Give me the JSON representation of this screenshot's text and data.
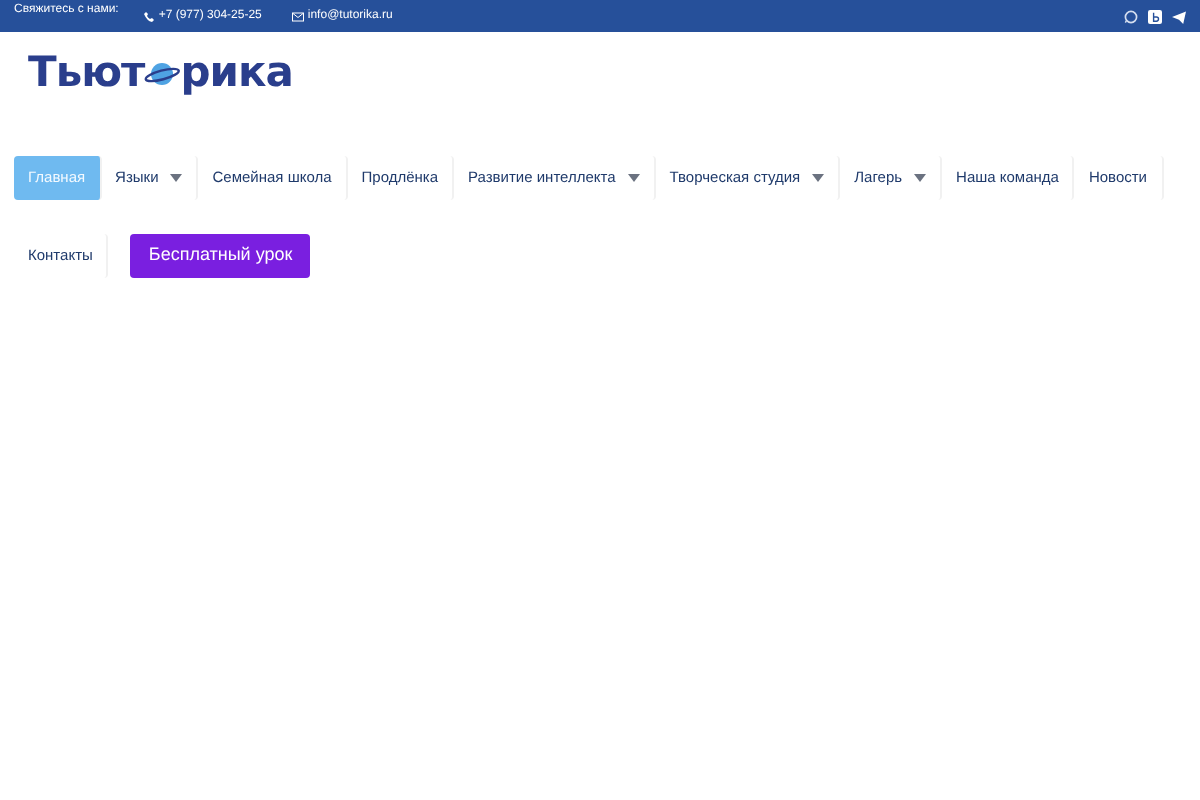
{
  "top_bar": {
    "contact_label": "Свяжитесь с нами:",
    "phone": "+7 (977) 304-25-25",
    "email": "info@tutorika.ru"
  },
  "logo": {
    "text_before_planet": "Тьют",
    "text_after_planet": "рика"
  },
  "nav": [
    {
      "label": "Главная",
      "selected": true,
      "kind": "link",
      "submenu": false
    },
    {
      "label": "Языки",
      "selected": false,
      "kind": "link",
      "submenu": true
    },
    {
      "label": "Семейная школа",
      "selected": false,
      "kind": "link",
      "submenu": false
    },
    {
      "label": "Продлёнка",
      "selected": false,
      "kind": "link",
      "submenu": false
    },
    {
      "label": "Развитие интеллекта",
      "selected": false,
      "kind": "link",
      "submenu": true
    },
    {
      "label": "Творческая студия",
      "selected": false,
      "kind": "link",
      "submenu": true
    },
    {
      "label": "Лагерь",
      "selected": false,
      "kind": "link",
      "submenu": true
    },
    {
      "label": "Наша команда",
      "selected": false,
      "kind": "link",
      "submenu": false
    },
    {
      "label": "Новости",
      "selected": false,
      "kind": "link",
      "submenu": false
    },
    {
      "label": "Контакты",
      "selected": false,
      "kind": "link",
      "submenu": false
    },
    {
      "label": "Бесплатный урок",
      "kind": "cta"
    }
  ]
}
